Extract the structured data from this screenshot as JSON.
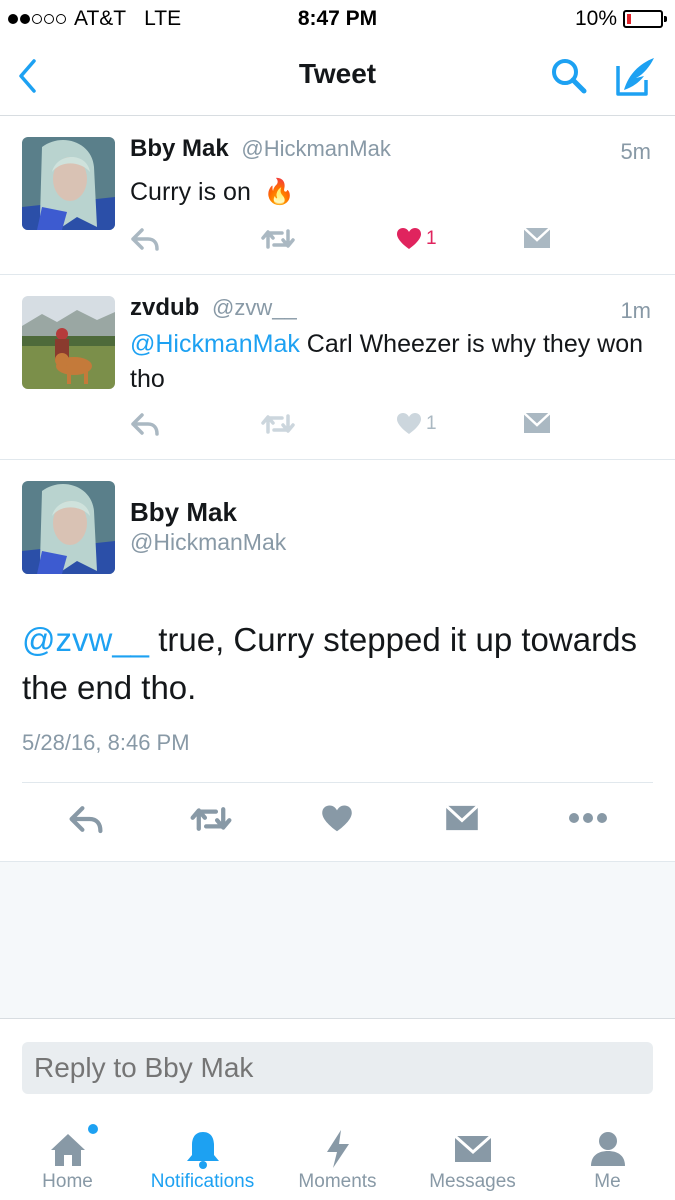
{
  "status": {
    "carrier": "AT&T",
    "network": "LTE",
    "time": "8:47 PM",
    "battery": "10%",
    "battery_level": 0.1
  },
  "nav": {
    "title": "Tweet",
    "back_icon": "chevron-left-icon",
    "search_icon": "search-icon",
    "compose_icon": "compose-icon",
    "accent": "#1da1f2"
  },
  "tweets": [
    {
      "name": "Bby Mak",
      "handle": "@HickmanMak",
      "time": "5m",
      "text": "Curry is on",
      "emoji": "🔥",
      "likes": "1",
      "liked": true
    },
    {
      "name": "zvdub",
      "handle": "@zvw__",
      "time": "1m",
      "mention": "@HickmanMak",
      "text": " Carl Wheezer is why they won tho",
      "likes": "1",
      "liked": false
    }
  ],
  "main_tweet": {
    "name": "Bby Mak",
    "handle": "@HickmanMak",
    "mention": "@zvw__",
    "text": "  true, Curry stepped it up towards the end tho.",
    "date": "5/28/16, 8:46 PM"
  },
  "reply": {
    "placeholder": "Reply to Bby Mak"
  },
  "tabs": [
    {
      "label": "Home",
      "icon": "home-icon"
    },
    {
      "label": "Notifications",
      "icon": "bell-icon",
      "active": true
    },
    {
      "label": "Moments",
      "icon": "lightning-icon"
    },
    {
      "label": "Messages",
      "icon": "envelope-icon"
    },
    {
      "label": "Me",
      "icon": "person-icon"
    }
  ],
  "colors": {
    "accent": "#1da1f2",
    "like": "#e0245e",
    "muted": "#8899a6"
  }
}
